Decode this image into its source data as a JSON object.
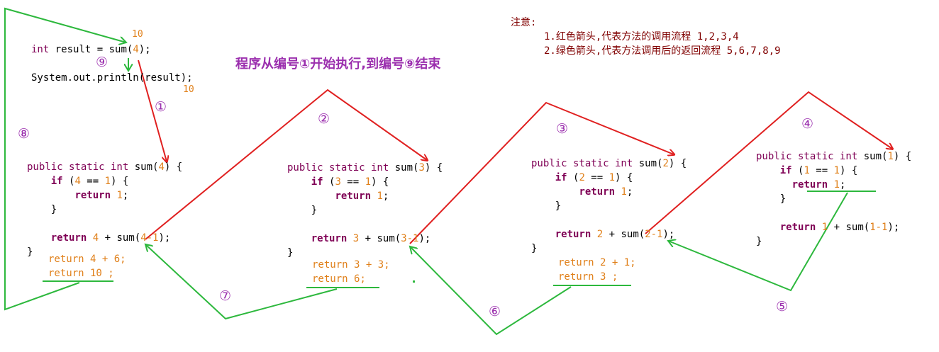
{
  "header": {
    "title": "程序从编号①开始执行,到编号⑨结束",
    "note_heading": "注意:",
    "note_line1": "1.红色箭头,代表方法的调用流程 1,2,3,4",
    "note_line2": "2.绿色箭头,代表方法调用后的返回流程 5,6,7,8,9"
  },
  "main_code": {
    "result_kw": "int",
    "result_rest": " result = sum(",
    "result_arg": "4",
    "result_end": ");",
    "println": "System.out.println(result);",
    "ann_result": "10",
    "ann_println": "10"
  },
  "steps": [
    "①",
    "②",
    "③",
    "④",
    "⑤",
    "⑥",
    "⑦",
    "⑧",
    "⑨"
  ],
  "methods": [
    {
      "sig_kw": "public static int",
      "sig_name": " sum(",
      "arg": "4",
      "sig_end": ") {",
      "if_kw": "if",
      "if_open": " (",
      "if_val": "4",
      "if_mid": " == ",
      "if_one": "1",
      "if_end": ") {",
      "ret_kw": "return",
      "ret_val": "1",
      "ret_semi": ";",
      "close_if": "}",
      "rec_kw": "return",
      "rec_n": "4",
      "rec_mid": " + sum(",
      "rec_arg": "4-1",
      "rec_end": ");",
      "close": "}",
      "eval1": "return 4 + 6;",
      "eval2": "return 10 ;"
    },
    {
      "sig_kw": "public static int",
      "sig_name": " sum(",
      "arg": "3",
      "sig_end": ") {",
      "if_kw": "if",
      "if_open": " (",
      "if_val": "3",
      "if_mid": " == ",
      "if_one": "1",
      "if_end": ") {",
      "ret_kw": "return",
      "ret_val": "1",
      "ret_semi": ";",
      "close_if": "}",
      "rec_kw": "return",
      "rec_n": "3",
      "rec_mid": " + sum(",
      "rec_arg": "3-1",
      "rec_end": ");",
      "close": "}",
      "eval1": "return 3 + 3;",
      "eval2": "return 6;"
    },
    {
      "sig_kw": "public static int",
      "sig_name": " sum(",
      "arg": "2",
      "sig_end": ") {",
      "if_kw": "if",
      "if_open": " (",
      "if_val": "2",
      "if_mid": " == ",
      "if_one": "1",
      "if_end": ") {",
      "ret_kw": "return",
      "ret_val": "1",
      "ret_semi": ";",
      "close_if": "}",
      "rec_kw": "return",
      "rec_n": "2",
      "rec_mid": " + sum(",
      "rec_arg": "2-1",
      "rec_end": ");",
      "close": "}",
      "eval1": "return 2 + 1;",
      "eval2": "return 3 ;"
    },
    {
      "sig_kw": "public static int",
      "sig_name": " sum(",
      "arg": "1",
      "sig_end": ") {",
      "if_kw": "if",
      "if_open": " (",
      "if_val": "1",
      "if_mid": " == ",
      "if_one": "1",
      "if_end": ") {",
      "ret_kw": "return",
      "ret_val": "1",
      "ret_semi": ";",
      "close_if": "}",
      "rec_kw": "return",
      "rec_n": "1",
      "rec_mid": " + sum(",
      "rec_arg": "1-1",
      "rec_end": ");",
      "close": "}"
    }
  ],
  "colors": {
    "call_arrow": "#e02020",
    "return_arrow": "#2db83d",
    "step_label": "#9b2fae",
    "keyword": "#7f0055",
    "literal": "#e0801a",
    "note": "#800000"
  }
}
